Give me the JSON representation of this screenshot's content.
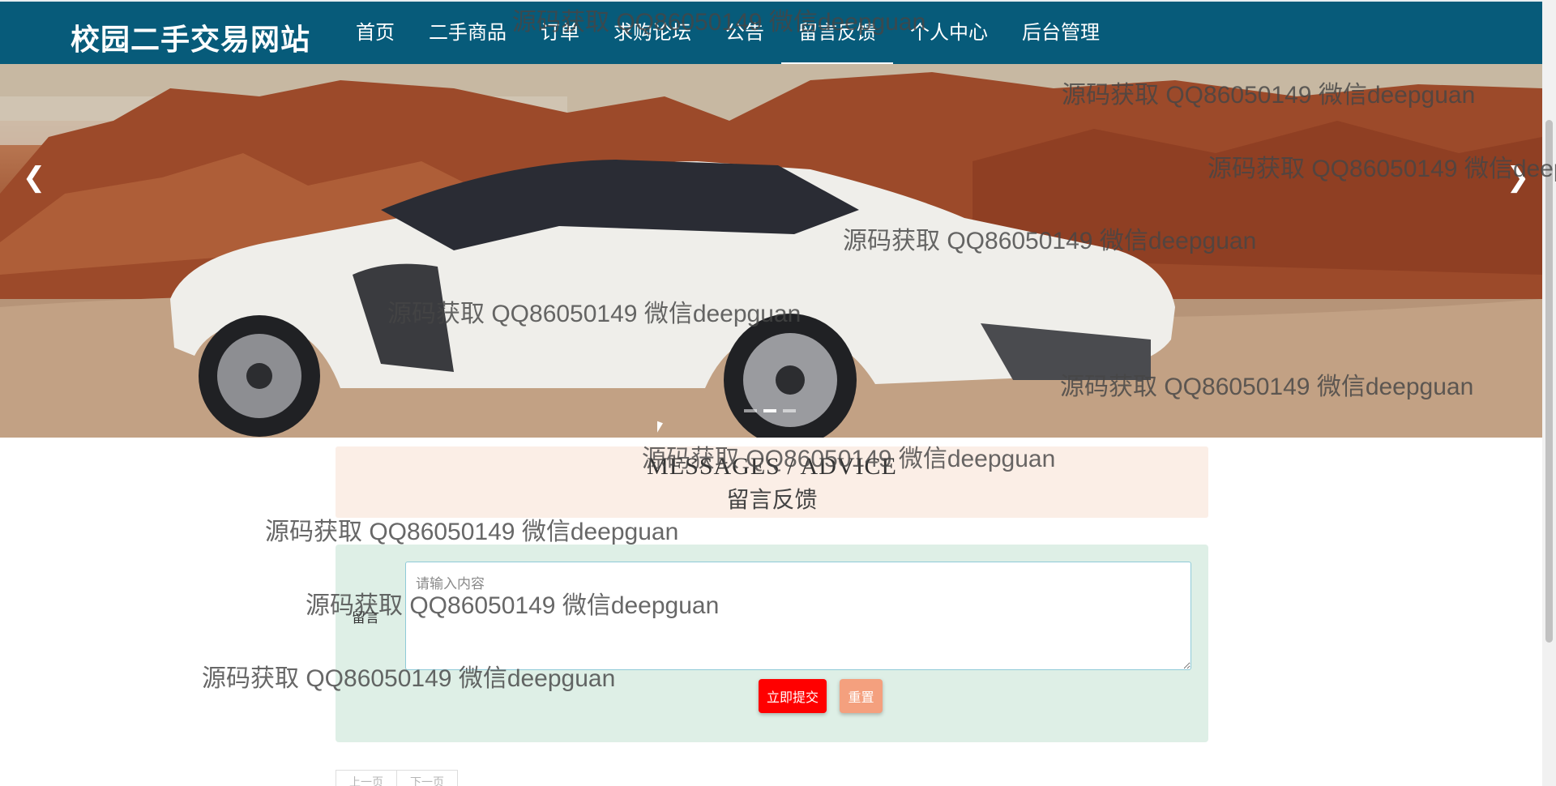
{
  "site": {
    "brand": "校园二手交易网站"
  },
  "nav": {
    "items": [
      {
        "label": "首页"
      },
      {
        "label": "二手商品"
      },
      {
        "label": "订单"
      },
      {
        "label": "求购论坛"
      },
      {
        "label": "公告"
      },
      {
        "label": "留言反馈",
        "active": true
      },
      {
        "label": "个人中心"
      },
      {
        "label": "后台管理"
      }
    ]
  },
  "banner": {
    "prev_icon": "chevron-left-icon",
    "next_icon": "chevron-right-icon",
    "slide_count": 3,
    "active_slide": 2,
    "image_subject": "white sports car in rocky desert"
  },
  "section": {
    "title_en": "MESSAGES / ADVICE",
    "title_cn": "留言反馈"
  },
  "form": {
    "label": "留言",
    "placeholder": "请输入内容",
    "value": "",
    "submit_label": "立即提交",
    "reset_label": "重置"
  },
  "pager": {
    "prev_label": "上一页",
    "next_label": "下一页"
  },
  "watermark": {
    "text": "源码获取 QQ86050149 微信deepguan"
  },
  "colors": {
    "header_bg": "#075b7a",
    "title_bg": "#fbeee6",
    "form_bg": "#deefe6",
    "submit": "#ff0000",
    "reset": "#f4a07e"
  }
}
